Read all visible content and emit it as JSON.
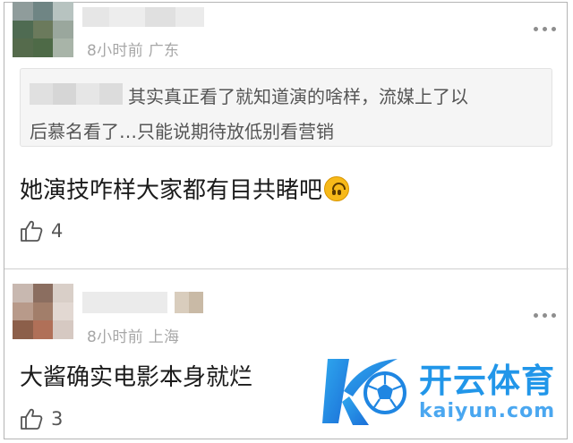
{
  "comment1": {
    "meta": "8小时前 广东",
    "quote": {
      "line1": "其实真正看了就知道演的啥样，流媒上了以",
      "line2": "后慕名看了…只能说期待放低别看营销"
    },
    "text": "她演技咋样大家都有目共睹吧",
    "emoji_icon": "upside-down-face-icon",
    "likes": "4"
  },
  "comment2": {
    "meta": "8小时前 上海",
    "text": "大酱确实电影本身就烂",
    "likes": "3"
  },
  "watermark": {
    "brand": "开云体育",
    "url": "kaiyun.com"
  },
  "colors": {
    "meta_gray": "#a7a7a7",
    "brand_blue": "#2196e9"
  }
}
